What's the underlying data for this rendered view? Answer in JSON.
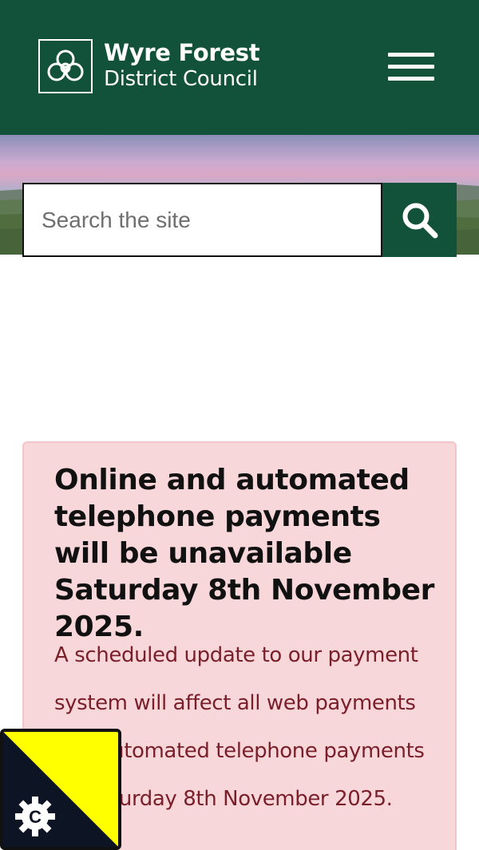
{
  "header": {
    "logo_line1": "Wyre Forest",
    "logo_line2": "District Council",
    "menu_icon": "hamburger-menu-icon",
    "background_color": "#13523a"
  },
  "search": {
    "placeholder": "Search the site",
    "button_icon": "search-icon"
  },
  "alert": {
    "title": "Online and automated telephone payments will be unavailable Saturday 8th November 2025.",
    "body": "A scheduled update to our payment system will affect all web payments and automated telephone payments on Saturday 8th November 2025.",
    "background_color": "#f8d7da",
    "text_color": "#7a1f2a"
  },
  "cookie_badge": {
    "icon": "cookie-settings-icon",
    "letter": "C",
    "colors": [
      "#0d1424",
      "#ffff00"
    ]
  }
}
